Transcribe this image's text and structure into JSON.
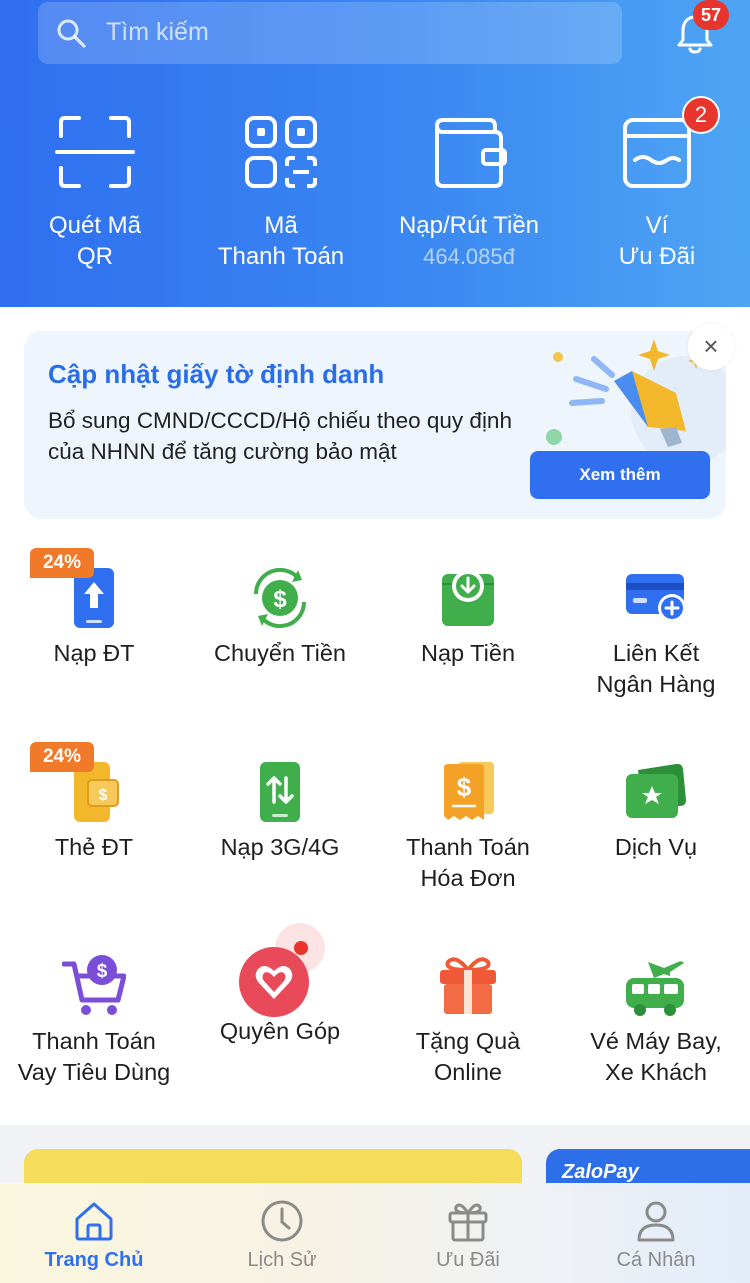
{
  "header": {
    "search_placeholder": "Tìm kiếm",
    "notification_count": "57"
  },
  "quick_actions": [
    {
      "l1": "Quét Mã",
      "l2": "QR"
    },
    {
      "l1": "Mã",
      "l2": "Thanh Toán"
    },
    {
      "l1": "Nạp/Rút Tiền",
      "l2": "464.085đ"
    },
    {
      "l1": "Ví",
      "l2": "Ưu Đãi",
      "badge": "2"
    }
  ],
  "banner": {
    "title": "Cập nhật giấy tờ định danh",
    "desc": "Bổ sung CMND/CCCD/Hộ chiếu theo quy định của NHNN để tăng cường bảo mật",
    "button": "Xem thêm",
    "close": "×"
  },
  "services": [
    {
      "t1": "Nạp ĐT",
      "t2": "",
      "tag": "24%",
      "icon": "phone-topup-icon"
    },
    {
      "t1": "Chuyển Tiền",
      "t2": "",
      "icon": "money-transfer-icon"
    },
    {
      "t1": "Nạp Tiền",
      "t2": "",
      "icon": "deposit-icon"
    },
    {
      "t1": "Liên Kết",
      "t2": "Ngân Hàng",
      "icon": "bank-link-icon"
    },
    {
      "t1": "Thẻ ĐT",
      "t2": "",
      "tag": "24%",
      "icon": "phone-card-icon"
    },
    {
      "t1": "Nạp 3G/4G",
      "t2": "",
      "icon": "data-topup-icon"
    },
    {
      "t1": "Thanh Toán",
      "t2": "Hóa Đơn",
      "icon": "bill-icon"
    },
    {
      "t1": "Dịch Vụ",
      "t2": "",
      "icon": "services-icon"
    },
    {
      "t1": "Thanh Toán",
      "t2": "Vay Tiêu Dùng",
      "icon": "loan-cart-icon"
    },
    {
      "t1": "Quyên Góp",
      "t2": "",
      "icon": "donation-heart-icon"
    },
    {
      "t1": "Tặng Quà",
      "t2": "Online",
      "icon": "gift-icon"
    },
    {
      "t1": "Vé Máy Bay,",
      "t2": "Xe Khách",
      "icon": "bus-plane-icon"
    }
  ],
  "promo": {
    "brand": "ZaloPay"
  },
  "nav": [
    {
      "label": "Trang Chủ",
      "active": true
    },
    {
      "label": "Lịch Sử"
    },
    {
      "label": "Ưu Đãi"
    },
    {
      "label": "Cá Nhân"
    }
  ],
  "colors": {
    "primary": "#2f6ff0",
    "badge": "#e8352d",
    "tag": "#f07a2a",
    "green": "#3fae4b"
  }
}
